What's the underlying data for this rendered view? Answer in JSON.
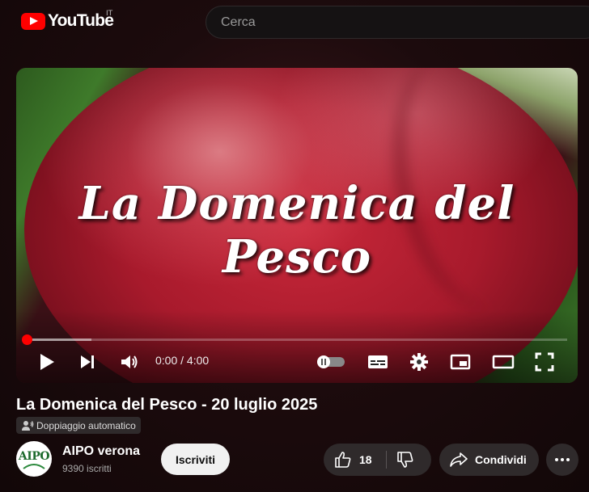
{
  "header": {
    "logo_text": "YouTube",
    "country_code": "IT",
    "search_placeholder": "Cerca"
  },
  "player": {
    "video_overlay_text": "La Domenica del Pesco",
    "current_time_display": "0:00 / 4:00",
    "progress_played_fraction": 0.0,
    "progress_buffered_fraction": 0.12
  },
  "video": {
    "title": "La Domenica del Pesco - 20 luglio 2025",
    "dub_badge": "Doppiaggio automatico"
  },
  "channel": {
    "avatar_text": "AIPO",
    "name": "AIPO verona",
    "subscribers": "9390 iscritti",
    "subscribe_label": "Iscriviti"
  },
  "actions": {
    "like_count": "18",
    "share_label": "Condividi"
  },
  "icons": [
    "play-icon",
    "next-icon",
    "volume-icon",
    "autoplay-toggle-icon",
    "subtitles-icon",
    "settings-gear-icon",
    "miniplayer-icon",
    "theater-mode-icon",
    "fullscreen-icon",
    "thumbs-up-icon",
    "thumbs-down-icon",
    "share-icon",
    "more-icon",
    "dub-icon"
  ],
  "colors": {
    "brand_red": "#ff0000",
    "button_bg": "#2f2a2b",
    "subscribe_bg": "#f1f1f1"
  }
}
